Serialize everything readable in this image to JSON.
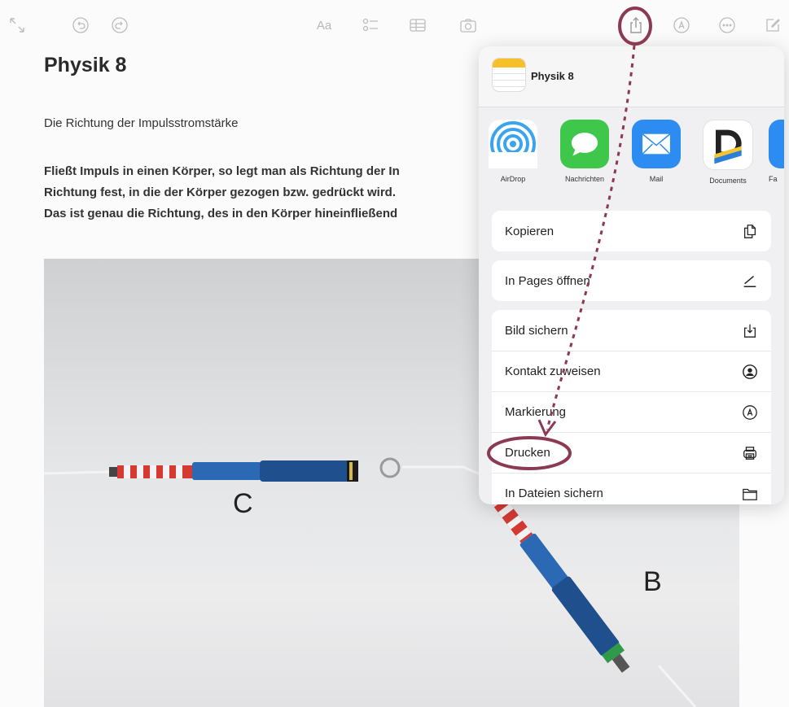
{
  "note": {
    "title": "Physik 8",
    "subtitle": "Die Richtung der Impulsstromstärke",
    "paragraph_lines": [
      "Fließt Impuls in einen Körper, so legt man als Richtung der In",
      "Richtung fest, in die der Körper gezogen bzw. gedrückt wird.",
      "Das ist genau die Richtung, des in den Körper hineinfließend"
    ],
    "photo_labels": {
      "c": "C",
      "b": "B"
    }
  },
  "toolbar": {
    "icons": [
      "collapse-icon",
      "undo-icon",
      "redo-icon",
      "text-format-icon",
      "checklist-icon",
      "table-icon",
      "camera-icon",
      "share-icon",
      "markup-icon",
      "more-icon",
      "compose-icon"
    ],
    "text_format_label": "Aa"
  },
  "share_sheet": {
    "note_title": "Physik 8",
    "apps": [
      {
        "label": "AirDrop"
      },
      {
        "label": "Nachrichten"
      },
      {
        "label": "Mail"
      },
      {
        "label": "Documents"
      },
      {
        "label": "Fa"
      }
    ],
    "actions_group1": [
      {
        "label": "Kopieren",
        "icon": "copy-icon"
      }
    ],
    "actions_group2": [
      {
        "label": "In Pages öffnen",
        "icon": "pen-icon"
      }
    ],
    "actions_group3": [
      {
        "label": "Bild sichern",
        "icon": "save-image-icon"
      },
      {
        "label": "Kontakt zuweisen",
        "icon": "contact-icon"
      },
      {
        "label": "Markierung",
        "icon": "markup-icon"
      },
      {
        "label": "Drucken",
        "icon": "print-icon"
      },
      {
        "label": "In Dateien sichern",
        "icon": "folder-icon"
      }
    ]
  },
  "annotation_color": "#8b3a52"
}
